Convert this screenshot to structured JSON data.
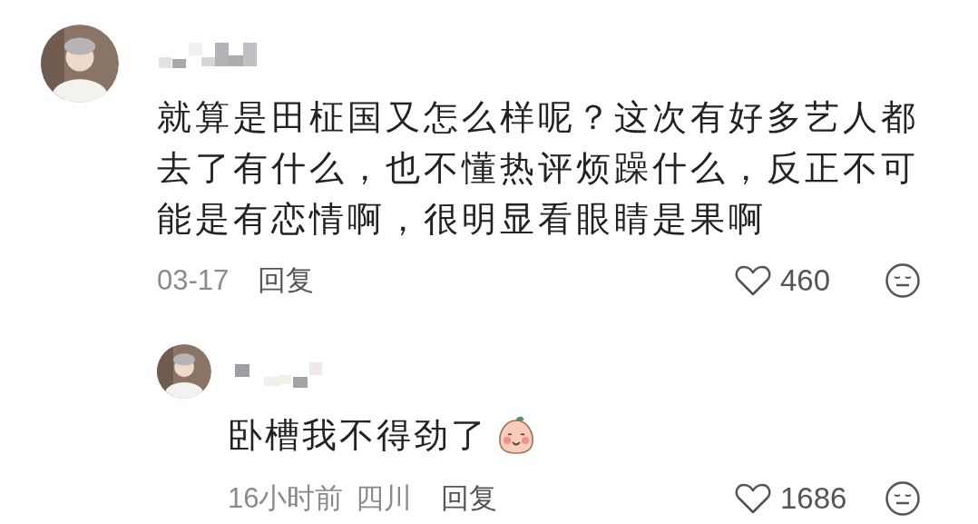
{
  "comments": [
    {
      "text": "就算是田柾国又怎么样呢？这次有好多艺人都去了有什么，也不懂热评烦躁什么，反正不可能是有恋情啊，很明显看眼睛是果啊",
      "time": "03-17",
      "reply_label": "回复",
      "likes": "460",
      "liked": false,
      "children": [
        {
          "text": "卧槽我不得劲了",
          "sticker": true,
          "time": "16小时前",
          "location": "四川",
          "reply_label": "回复",
          "likes": "1686",
          "liked": false
        }
      ]
    }
  ]
}
